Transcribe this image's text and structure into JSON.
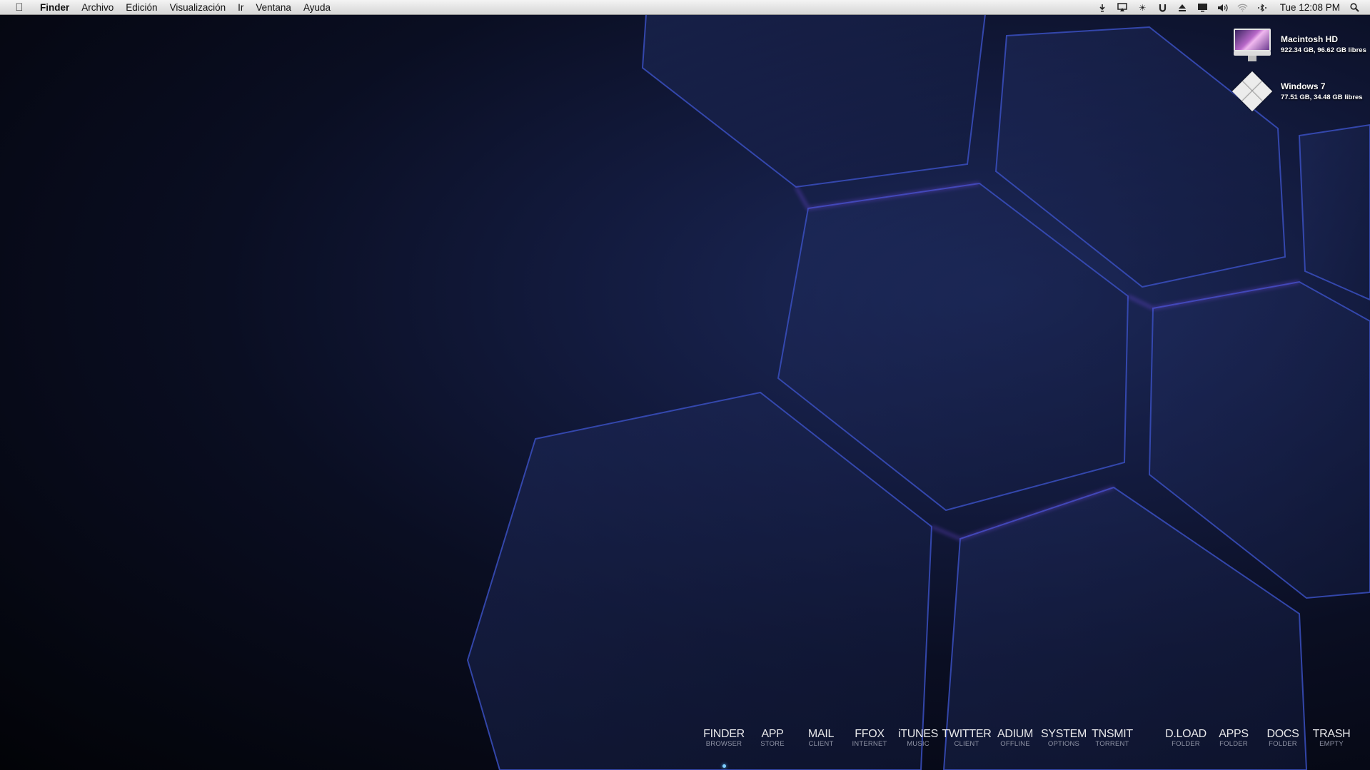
{
  "menubar": {
    "apple_icon": "apple-logo-icon",
    "items": [
      "Finder",
      "Archivo",
      "Edición",
      "Visualización",
      "Ir",
      "Ventana",
      "Ayuda"
    ],
    "status_icons": [
      "download-arrow-icon",
      "airplay-icon",
      "brightness-icon",
      "magnet-icon",
      "eject-icon",
      "display-icon",
      "volume-icon",
      "wifi-icon",
      "bluetooth-icon"
    ],
    "clock": "Tue 12:08 PM",
    "spotlight_icon": "search-icon"
  },
  "drives": [
    {
      "name": "Macintosh HD",
      "info": "922.34 GB, 96.62 GB libres",
      "icon": "imac-drive-icon"
    },
    {
      "name": "Windows 7",
      "info": "77.51 GB, 34.48 GB libres",
      "icon": "windows-drive-icon"
    }
  ],
  "dock": [
    {
      "label": "FINDER",
      "sub": "BROWSER"
    },
    {
      "label": "APP",
      "sub": "STORE"
    },
    {
      "label": "MAIL",
      "sub": "CLIENT"
    },
    {
      "label": "FFOX",
      "sub": "INTERNET"
    },
    {
      "label": "iTUNES",
      "sub": "MUSIC"
    },
    {
      "label": "TWITTER",
      "sub": "CLIENT"
    },
    {
      "label": "ADIUM",
      "sub": "OFFLINE"
    },
    {
      "label": "SYSTEM",
      "sub": "OPTIONS"
    },
    {
      "label": "TNSMIT",
      "sub": "TORRENT"
    },
    {
      "label": "D.LOAD",
      "sub": "FOLDER"
    },
    {
      "label": "APPS",
      "sub": "FOLDER"
    },
    {
      "label": "DOCS",
      "sub": "FOLDER"
    },
    {
      "label": "TRASH",
      "sub": "EMPTY"
    }
  ],
  "colors": {
    "hex_edge": "#3b4fb8",
    "hex_glow": "#6a45d6",
    "hex_fill": "#1a2552"
  }
}
